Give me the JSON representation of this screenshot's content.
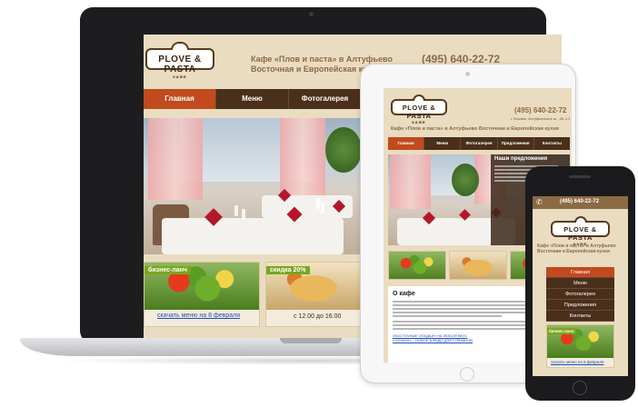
{
  "brand": {
    "logo_text": "PLOVE & PASTA",
    "logo_sub": "КАФЕ",
    "tagline_line1": "Кафе «Плов и паста» в Алтуфьево",
    "tagline_line2": "Восточная и Европейская кухня",
    "phone": "(495) 640-22-72",
    "address": "г. Москва, Алтуфьевское ш., 48, к.1"
  },
  "nav": [
    {
      "label": "Главная",
      "active": true
    },
    {
      "label": "Меню",
      "active": false
    },
    {
      "label": "Фотогалерея",
      "active": false
    },
    {
      "label": "Предложения",
      "active": false
    },
    {
      "label": "Контакты",
      "active": false
    }
  ],
  "promos": {
    "lunch_badge": "бизнес-ланч",
    "lunch_link": "скачать меню на 8 февраля",
    "discount_badge": "скидка 20%",
    "discount_time": "с 12.00 до 16.00"
  },
  "tablet": {
    "offers_title": "Наши предложения",
    "about_title": "О кафе",
    "news_1": "«ВОСТОЧНЫЕ ОЛАДЬИ» НА ЛЮБОЙ ВКУС",
    "news_2": "«ХУМАРА» – НОВОЕ БЛЮДО ДЛЯ ГУРМАНОВ",
    "lunch_link": "скачать меню на 8 февраля"
  },
  "phone": {
    "nav": [
      {
        "label": "Главная",
        "active": true
      },
      {
        "label": "Меню",
        "active": false
      },
      {
        "label": "Фотогалерея",
        "active": false
      },
      {
        "label": "Предложения",
        "active": false
      },
      {
        "label": "Контакты",
        "active": false
      }
    ],
    "lunch_badge": "бизнес-ланч",
    "lunch_link": "скачать меню на 8 февраля"
  }
}
